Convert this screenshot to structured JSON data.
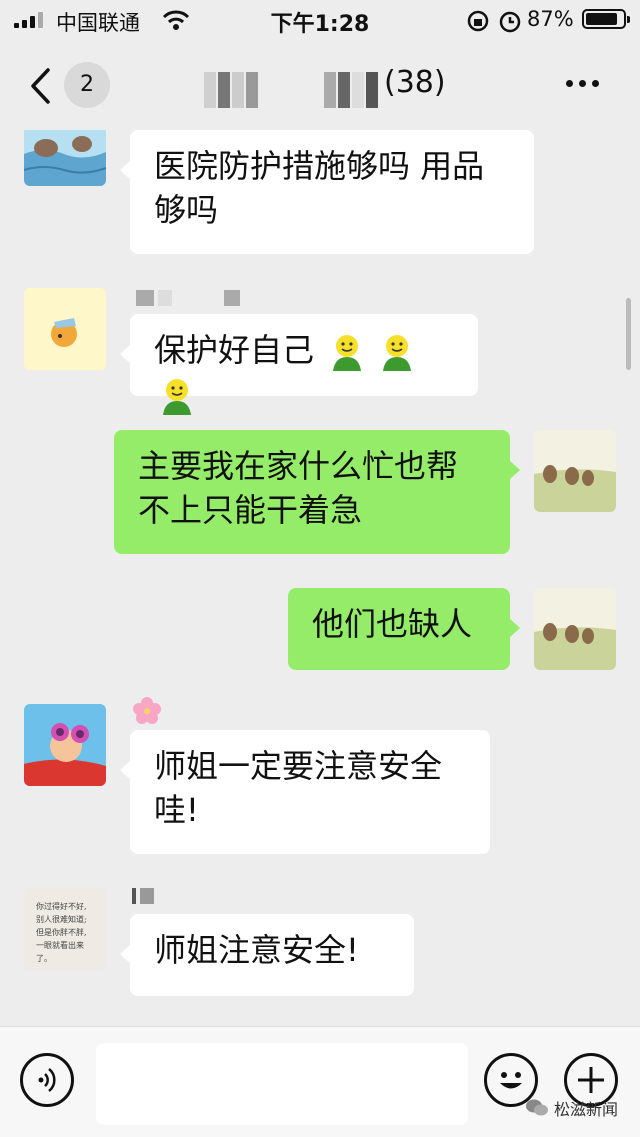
{
  "status_bar": {
    "carrier": "中国联通",
    "time": "下午1:28",
    "battery_percent": "87%",
    "battery_level": 0.87
  },
  "nav": {
    "unread_count": "2",
    "title": "(38)"
  },
  "messages": [
    {
      "side": "left",
      "sender_obscured": true,
      "text_lines": [
        "医院防护措施够吗 用品",
        "够吗"
      ]
    },
    {
      "side": "left",
      "text": "保护好自己",
      "trailing_emoji": [
        "smile-emoji-icon",
        "smile-emoji-icon",
        "smile-emoji-icon"
      ]
    },
    {
      "side": "right",
      "text_lines": [
        "主要我在家什么忙也帮",
        "不上只能干着急"
      ]
    },
    {
      "side": "right",
      "text": "他们也缺人"
    },
    {
      "side": "left",
      "sender_icon": "cherry-blossom-icon",
      "text_lines": [
        "师姐一定要注意安全",
        "哇!"
      ]
    },
    {
      "side": "left",
      "text": "师姐注意安全!"
    }
  ],
  "avatar_note_lines": [
    "你过得好不好,",
    "别人很难知道;",
    "但是你胖不胖,",
    "一眼就看出来了。"
  ],
  "input_bar": {
    "placeholder": ""
  },
  "watermark": "松滋新闻",
  "colors": {
    "background": "#ededed",
    "bubble_left": "#ffffff",
    "bubble_right": "#95ec69"
  }
}
